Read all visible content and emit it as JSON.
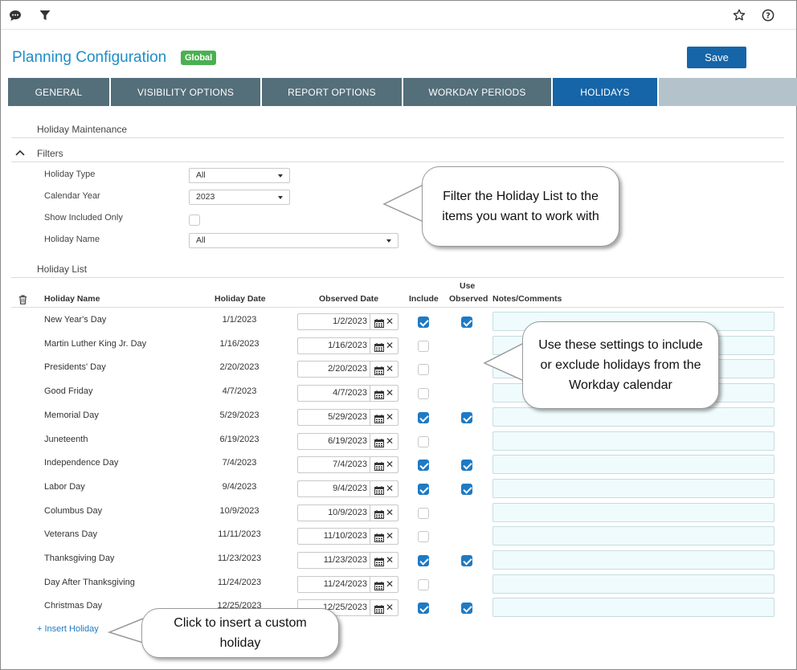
{
  "toolbar": {
    "chat_icon": "chat-bubble-icon",
    "filter_icon": "funnel-icon",
    "star_icon": "star-icon",
    "help_icon": "help-icon"
  },
  "header": {
    "title": "Planning Configuration",
    "badge": "Global",
    "save_label": "Save"
  },
  "tabs": [
    {
      "label": "GENERAL"
    },
    {
      "label": "VISIBILITY OPTIONS"
    },
    {
      "label": "REPORT OPTIONS"
    },
    {
      "label": "WORKDAY PERIODS"
    },
    {
      "label": "HOLIDAYS"
    }
  ],
  "section_title": "Holiday Maintenance",
  "filters": {
    "title": "Filters",
    "holiday_type": {
      "label": "Holiday Type",
      "value": "All"
    },
    "calendar_year": {
      "label": "Calendar Year",
      "value": "2023"
    },
    "show_included_only": {
      "label": "Show Included Only",
      "checked": false
    },
    "holiday_name": {
      "label": "Holiday Name",
      "value": "All"
    }
  },
  "list": {
    "title": "Holiday List",
    "columns": {
      "name": "Holiday Name",
      "date": "Holiday Date",
      "observed": "Observed Date",
      "include": "Include",
      "use_observed_1": "Use",
      "use_observed_2": "Observed",
      "notes": "Notes/Comments"
    },
    "rows": [
      {
        "name": "New Year's Day",
        "date": "1/1/2023",
        "observed": "1/2/2023",
        "include": true,
        "use_observed": true
      },
      {
        "name": "Martin Luther King Jr. Day",
        "date": "1/16/2023",
        "observed": "1/16/2023",
        "include": false,
        "use_observed": null
      },
      {
        "name": "Presidents' Day",
        "date": "2/20/2023",
        "observed": "2/20/2023",
        "include": false,
        "use_observed": null
      },
      {
        "name": "Good Friday",
        "date": "4/7/2023",
        "observed": "4/7/2023",
        "include": false,
        "use_observed": null
      },
      {
        "name": "Memorial Day",
        "date": "5/29/2023",
        "observed": "5/29/2023",
        "include": true,
        "use_observed": true
      },
      {
        "name": "Juneteenth",
        "date": "6/19/2023",
        "observed": "6/19/2023",
        "include": false,
        "use_observed": null
      },
      {
        "name": "Independence Day",
        "date": "7/4/2023",
        "observed": "7/4/2023",
        "include": true,
        "use_observed": true
      },
      {
        "name": "Labor Day",
        "date": "9/4/2023",
        "observed": "9/4/2023",
        "include": true,
        "use_observed": true
      },
      {
        "name": "Columbus Day",
        "date": "10/9/2023",
        "observed": "10/9/2023",
        "include": false,
        "use_observed": null
      },
      {
        "name": "Veterans Day",
        "date": "11/11/2023",
        "observed": "11/10/2023",
        "include": false,
        "use_observed": null
      },
      {
        "name": "Thanksgiving Day",
        "date": "11/23/2023",
        "observed": "11/23/2023",
        "include": true,
        "use_observed": true
      },
      {
        "name": "Day After Thanksgiving",
        "date": "11/24/2023",
        "observed": "11/24/2023",
        "include": false,
        "use_observed": null
      },
      {
        "name": "Christmas Day",
        "date": "12/25/2023",
        "observed": "12/25/2023",
        "include": true,
        "use_observed": true
      }
    ],
    "insert_label": "+ Insert Holiday"
  },
  "callouts": {
    "filter": "Filter the Holiday List to the items you want to work with",
    "settings": "Use these settings to include or exclude holidays from the Workday calendar",
    "insert": "Click to insert a custom holiday"
  },
  "colors": {
    "accent": "#1565a8",
    "tab_inactive": "#546e7a",
    "badge": "#4bb052",
    "title": "#1e8ec7",
    "notes_bg": "#effbfc"
  }
}
